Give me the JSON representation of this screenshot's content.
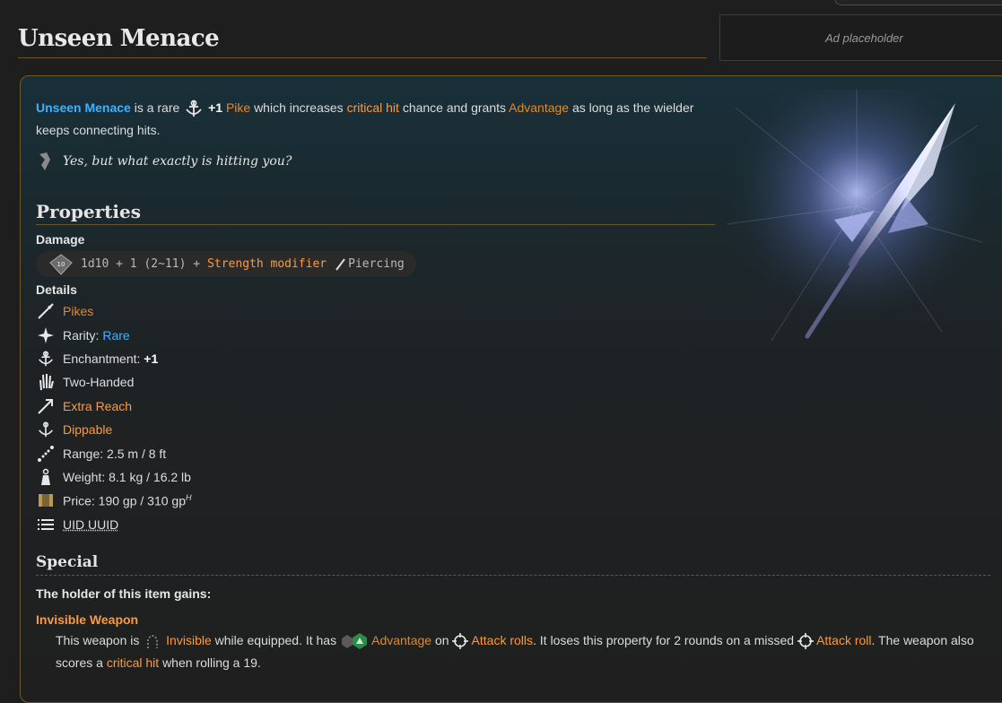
{
  "page": {
    "title": "Unseen Menace"
  },
  "ad": {
    "text": "Ad placeholder"
  },
  "intro": {
    "name": "Unseen Menace",
    "is_a": "is a rare",
    "enchant": "+1",
    "type": "Pike",
    "which": "which increases",
    "crit": "critical hit",
    "grants": "chance and grants",
    "advantage": "Advantage",
    "rest": "as long as the wielder keeps connecting hits."
  },
  "quote": "Yes, but what exactly is hitting you?",
  "properties": {
    "title": "Properties",
    "damage_label": "Damage",
    "damage": {
      "dice": "1d10 + 1 (2~11) +",
      "modifier": "Strength modifier",
      "type": "Piercing"
    },
    "details_label": "Details",
    "details": [
      {
        "icon": "pike-icon",
        "prefix": "",
        "text": "Pikes",
        "style": "orange"
      },
      {
        "icon": "sparkle-icon",
        "prefix": "Rarity: ",
        "text": "Rare",
        "style": "blue"
      },
      {
        "icon": "enchantment-icon",
        "prefix": "Enchantment: ",
        "text": "+1",
        "style": "bold"
      },
      {
        "icon": "hand-icon",
        "prefix": "",
        "text": "Two-Handed",
        "style": "plain"
      },
      {
        "icon": "reach-icon",
        "prefix": "",
        "text": "Extra Reach",
        "style": "bright"
      },
      {
        "icon": "dippable-icon",
        "prefix": "",
        "text": "Dippable",
        "style": "bright"
      },
      {
        "icon": "range-icon",
        "prefix": "",
        "text": "Range: 2.5 m / 8 ft",
        "style": "plain"
      },
      {
        "icon": "weight-icon",
        "prefix": "",
        "text": "Weight: 8.1 kg / 16.2 lb",
        "style": "plain"
      },
      {
        "icon": "price-icon",
        "prefix": "",
        "text": "Price: 190 gp / 310 gp",
        "style": "plain",
        "sup": "H"
      },
      {
        "icon": "list-icon",
        "prefix": "",
        "text": "UID UUID",
        "style": "dotted"
      }
    ]
  },
  "special": {
    "title": "Special",
    "holder": "The holder of this item gains:",
    "ability_name": "Invisible Weapon",
    "desc": {
      "p1": "This weapon is",
      "invisible": "Invisible",
      "p2": "while equipped. It has",
      "advantage": "Advantage",
      "p3": "on",
      "attack_rolls": "Attack rolls",
      "p4": ". It loses this property for 2 rounds on a missed",
      "attack_roll": "Attack roll",
      "p5": ". The weapon also scores a",
      "crit": "critical hit",
      "p6": "when rolling a 19."
    }
  },
  "colors": {
    "accent_blue": "#3fb2ff",
    "accent_orange": "#e08a2c",
    "border_gold": "#6a5a2a"
  }
}
